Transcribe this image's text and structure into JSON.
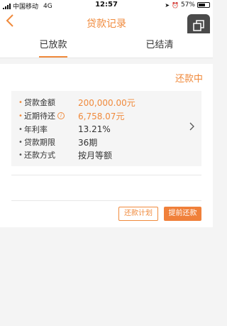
{
  "status_bar": {
    "carrier": "中国移动",
    "network": "4G",
    "time": "12:57",
    "battery": "57%"
  },
  "nav": {
    "title": "贷款记录"
  },
  "tabs": [
    {
      "label": "已放款",
      "active": true
    },
    {
      "label": "已结清",
      "active": false
    }
  ],
  "loan": {
    "status": "还款中",
    "rows": [
      {
        "label": "贷款金额",
        "value": "200,000.00元"
      },
      {
        "label": "近期待还",
        "value": "6,758.07元"
      },
      {
        "label": "年利率",
        "value": "13.21%"
      },
      {
        "label": "贷款期限",
        "value": "36期"
      },
      {
        "label": "还款方式",
        "value": "按月等额"
      }
    ]
  },
  "actions": {
    "repayment_plan": "还款计划",
    "early_repayment": "提前还款"
  },
  "colors": {
    "accent": "#f08a3c"
  },
  "icons": {
    "back": "chevron-left-icon",
    "detail": "chevron-right-icon",
    "info": "info-icon",
    "float": "window-icon"
  }
}
